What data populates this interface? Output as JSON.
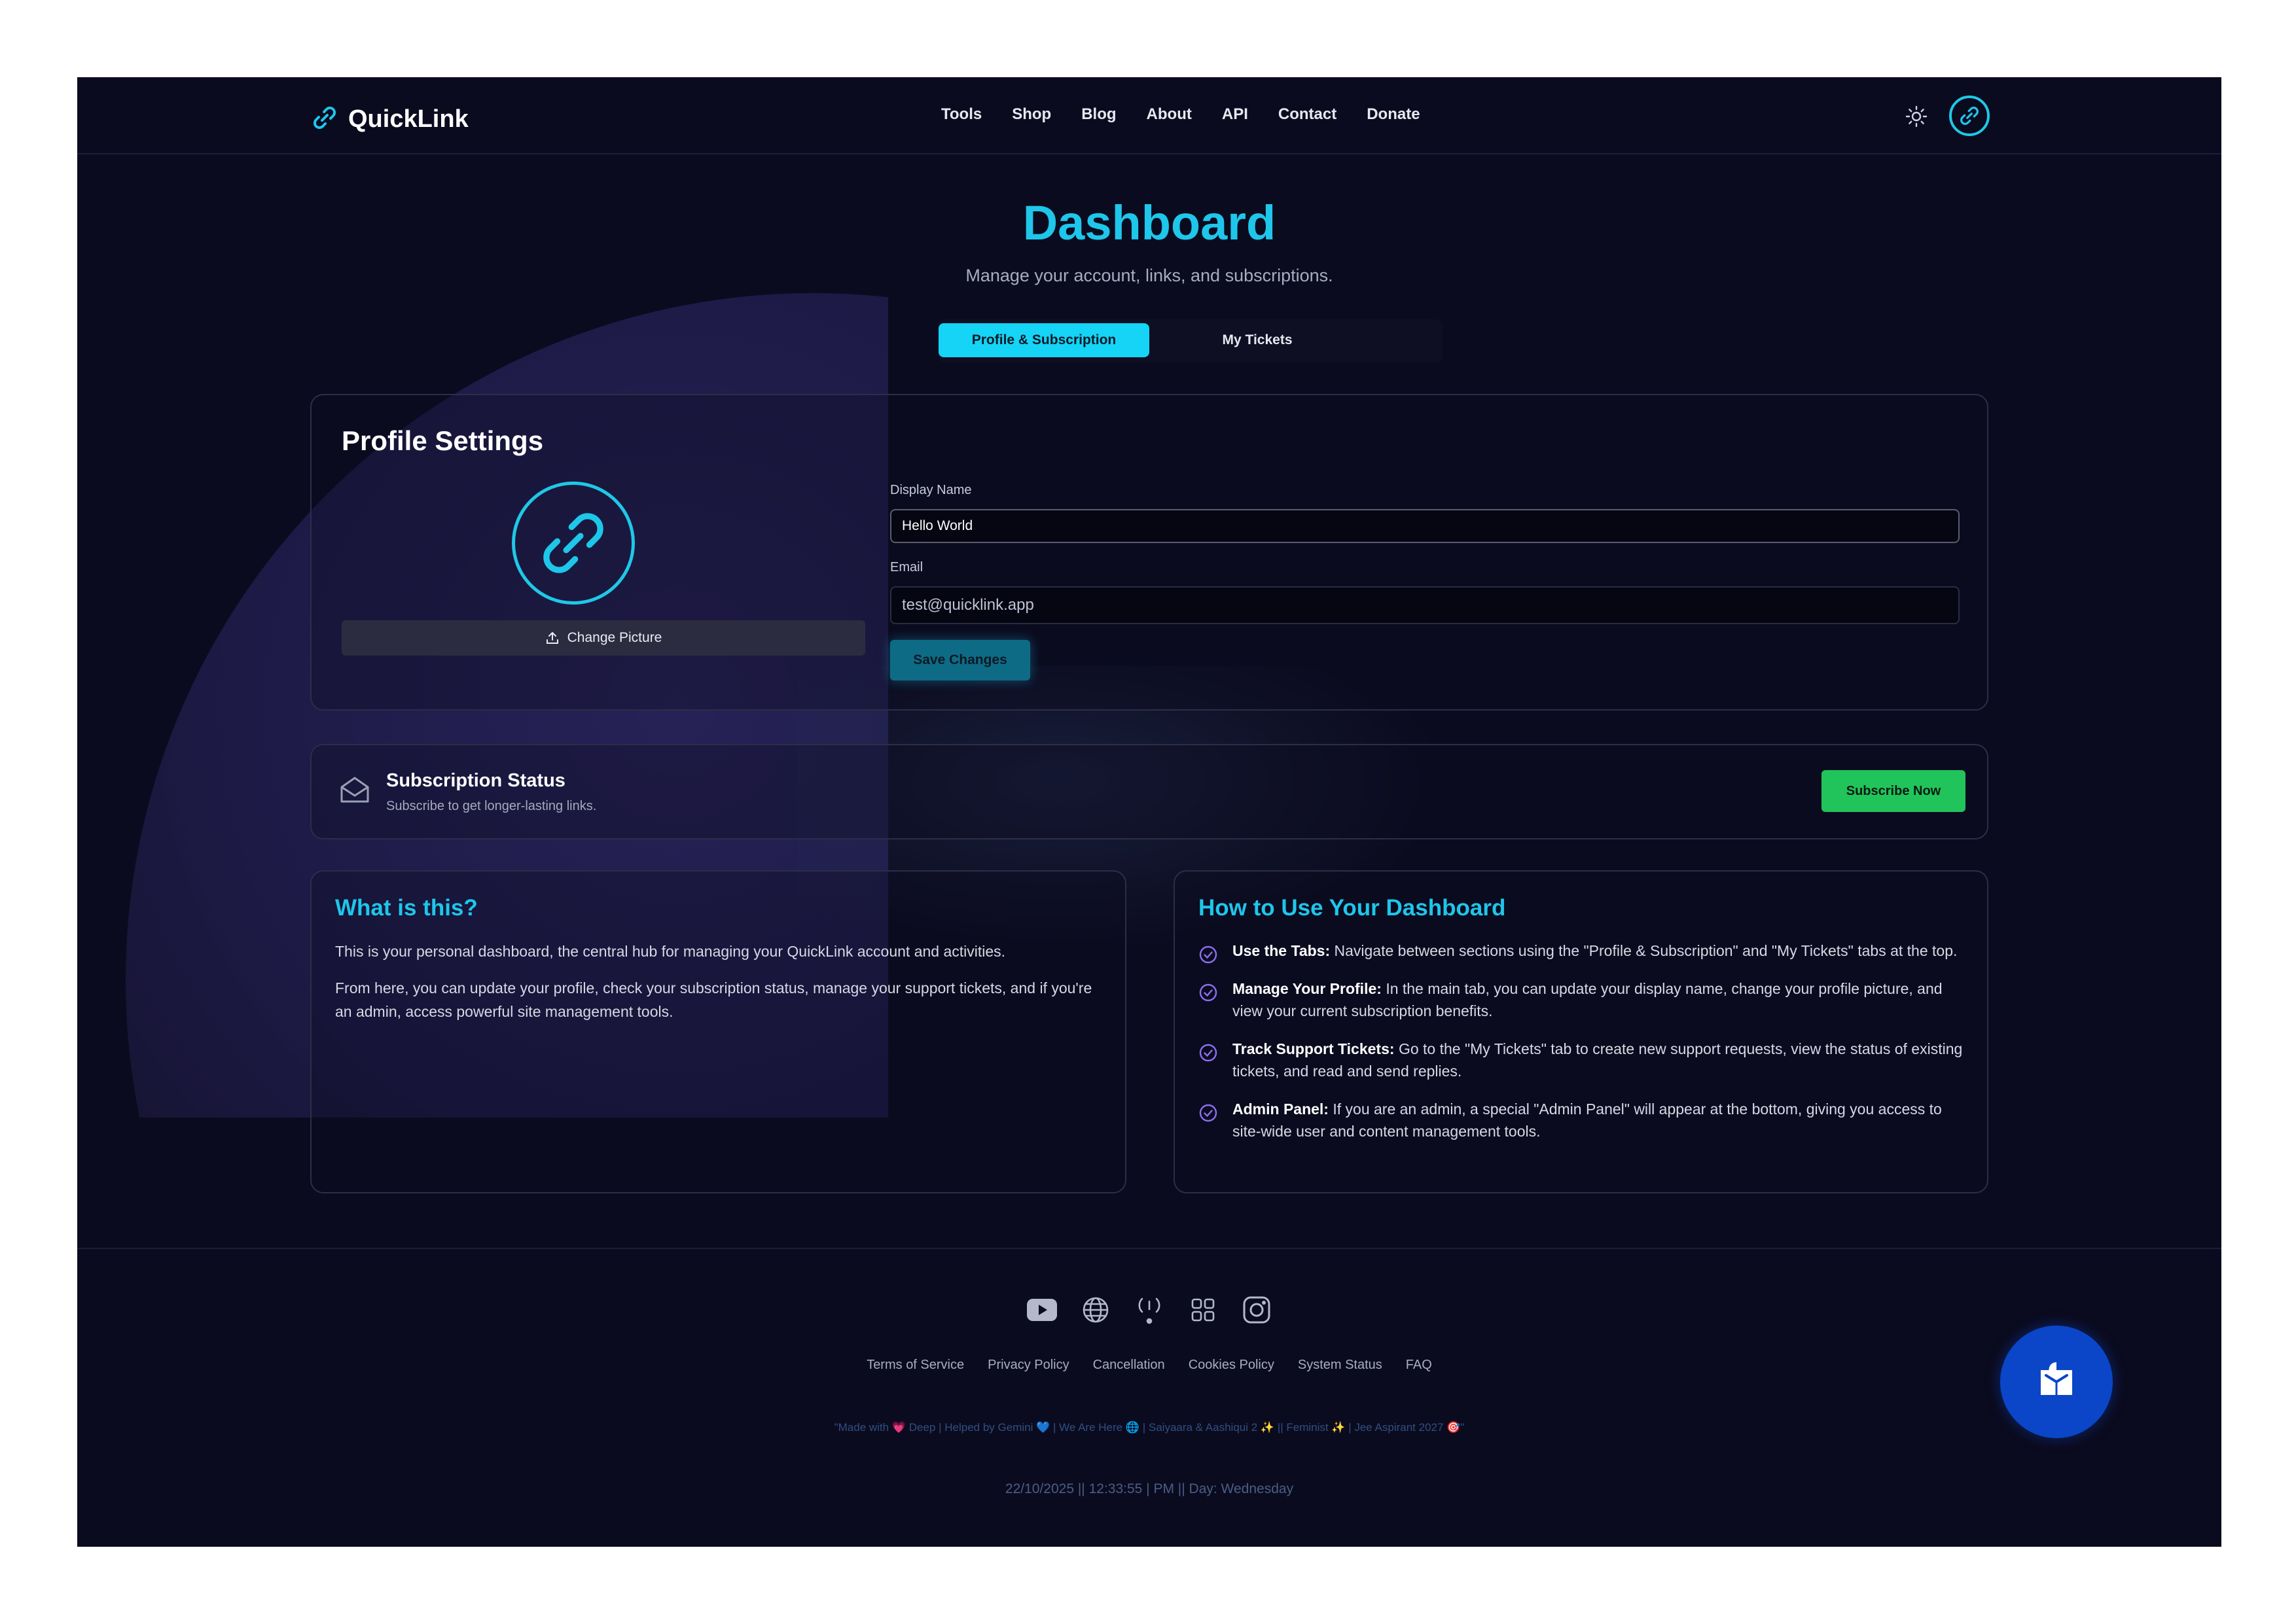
{
  "header": {
    "brand": "QuickLink",
    "nav": [
      "Tools",
      "Shop",
      "Blog",
      "About",
      "API",
      "Contact",
      "Donate"
    ]
  },
  "hero": {
    "title": "Dashboard",
    "subtitle": "Manage your account, links, and subscriptions."
  },
  "tabs": [
    {
      "label": "Profile & Subscription",
      "active": true
    },
    {
      "label": "My Tickets",
      "active": false
    }
  ],
  "profile": {
    "title": "Profile Settings",
    "change_picture": "Change Picture",
    "display_name_label": "Display Name",
    "display_name_value": "Hello World",
    "email_label": "Email",
    "email_value": "test@quicklink.app",
    "save": "Save Changes"
  },
  "subscription": {
    "title": "Subscription Status",
    "description": "Subscribe to get longer-lasting links.",
    "button": "Subscribe Now"
  },
  "what": {
    "title": "What is this?",
    "p1": "This is your personal dashboard, the central hub for managing your QuickLink account and activities.",
    "p2": "From here, you can update your profile, check your subscription status, manage your support tickets, and if you're an admin, access powerful site management tools."
  },
  "how": {
    "title": "How to Use Your Dashboard",
    "items": [
      {
        "label": "Use the Tabs:",
        "text": "Navigate between sections using the \"Profile & Subscription\" and \"My Tickets\" tabs at the top."
      },
      {
        "label": "Manage Your Profile:",
        "text": "In the main tab, you can update your display name, change your profile picture, and view your current subscription benefits."
      },
      {
        "label": "Track Support Tickets:",
        "text": "Go to the \"My Tickets\" tab to create new support requests, view the status of existing tickets, and read and send replies."
      },
      {
        "label": "Admin Panel:",
        "text": "If you are an admin, a special \"Admin Panel\" will appear at the bottom, giving you access to site-wide user and content management tools."
      }
    ]
  },
  "footer": {
    "socials": [
      "youtube-icon",
      "globe-icon",
      "signal-icon",
      "apps-icon",
      "instagram-icon"
    ],
    "links": [
      "Terms of Service",
      "Privacy Policy",
      "Cancellation",
      "Cookies Policy",
      "System Status",
      "FAQ"
    ],
    "credit": "\"Made with 💗 Deep | Helped by Gemini 💙 | We Are Here 🌐 | Saiyaara & Aashiqui 2 ✨ || Feminist ✨ | Jee Aspirant 2027 🎯\"",
    "clock": "22/10/2025 || 12:33:55 | PM || Day: Wednesday"
  },
  "colors": {
    "background": "#0b0b1f",
    "accent": "#1ec6ea",
    "success": "#21c45a",
    "chat": "#0b46c8"
  }
}
